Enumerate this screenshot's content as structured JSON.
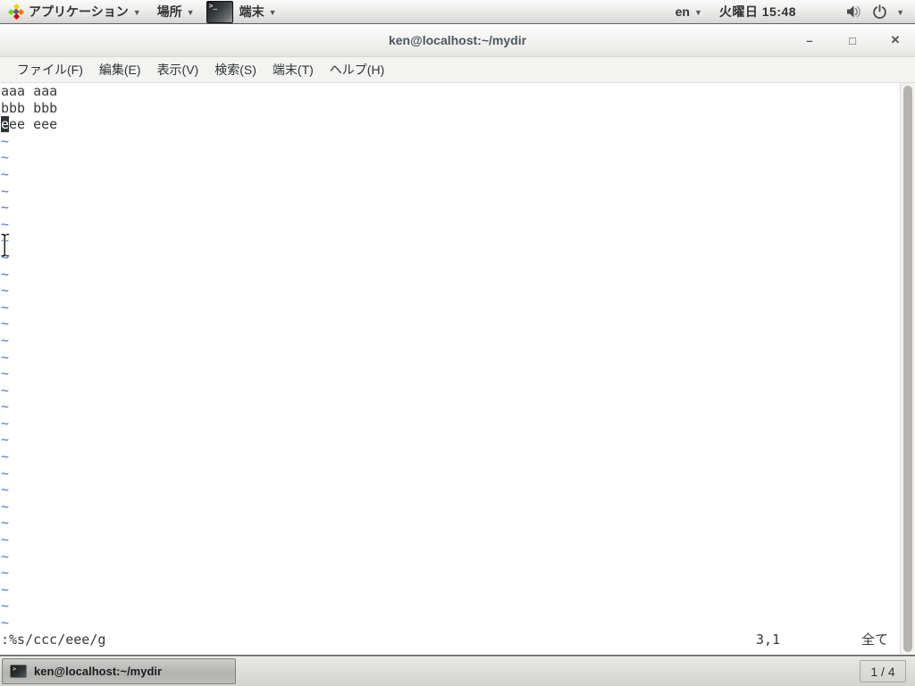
{
  "top_panel": {
    "applications_menu": "アプリケーション",
    "places_menu": "場所",
    "active_app_menu": "端末",
    "keyboard_layout": "en",
    "clock": "火曜日 15:48"
  },
  "window": {
    "title": "ken@localhost:~/mydir",
    "controls": {
      "minimize": "–",
      "maximize": "□",
      "close": "✕"
    },
    "menu_bar": [
      "ファイル(F)",
      "編集(E)",
      "表示(V)",
      "検索(S)",
      "端末(T)",
      "ヘルプ(H)"
    ]
  },
  "terminal": {
    "buffer_lines": [
      "aaa aaa",
      "bbb bbb",
      "eee eee"
    ],
    "line1": "aaa aaa",
    "line2": "bbb bbb",
    "cursor_char": "e",
    "line3_rest": "ee eee",
    "empty_line_char": "~",
    "empty_line_count": 30,
    "command_line": ":%s/ccc/eee/g",
    "ruler": "3,1",
    "scroll_position": "全て"
  },
  "taskbar": {
    "task_button_label": "ken@localhost:~/mydir",
    "workspace_indicator": "1 / 4"
  },
  "colors": {
    "tilde_blue": "#4f7cbf",
    "terminal_fg": "#36393b",
    "cursor_bg": "#2e3436",
    "panel_text": "#333333",
    "title_text": "#4c565e"
  }
}
